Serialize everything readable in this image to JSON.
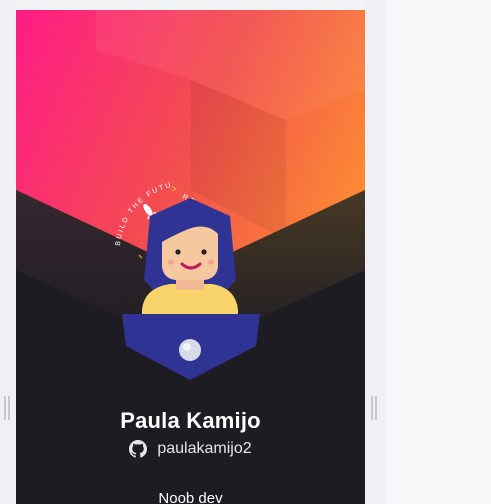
{
  "profile": {
    "name": "Paula Kamijo",
    "github_username": "paulakamijo2",
    "bio": "Noob dev"
  },
  "badge": {
    "ring_text_left": "BUILD THE FUTURE",
    "ring_text_right": "ROCKETSEAT"
  },
  "icons": {
    "github": "github-icon",
    "rocket": "rocket-icon"
  },
  "colors": {
    "gradient_start": "#ff1b86",
    "gradient_mid": "#f2504c",
    "gradient_end": "#ff9a2e",
    "card_dark": "#1d1c22",
    "avatar_hair": "#2f3494",
    "avatar_skin": "#f6c8a0",
    "avatar_shirt": "#f9d46b"
  }
}
